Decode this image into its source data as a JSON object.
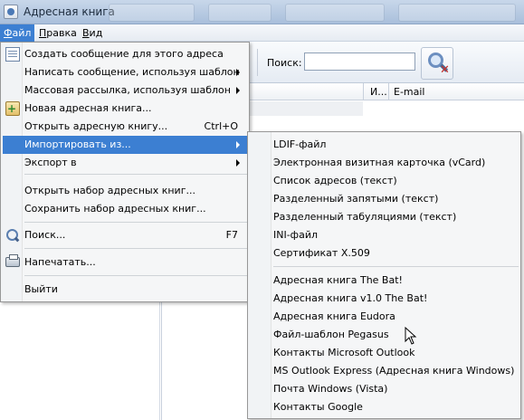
{
  "window": {
    "title": "Адресная книга"
  },
  "menubar": {
    "items": [
      {
        "label": "Файл",
        "underline": "Ф",
        "active": true
      },
      {
        "label": "Правка",
        "underline": "П",
        "active": false
      },
      {
        "label": "Вид",
        "underline": "В",
        "active": false
      }
    ]
  },
  "toolbar": {
    "search_label": "Поиск:",
    "search_value": ""
  },
  "grid": {
    "columns": [
      "И...",
      "E-mail"
    ]
  },
  "file_menu": {
    "items": [
      {
        "label": "Создать сообщение для этого адреса",
        "shortcut": "",
        "submenu": false,
        "icon": "new-message-icon"
      },
      {
        "label": "Написать сообщение, используя шаблон",
        "shortcut": "",
        "submenu": true
      },
      {
        "label": "Массовая рассылка, используя шаблон",
        "shortcut": "",
        "submenu": true
      },
      {
        "label": "Новая адресная книга...",
        "shortcut": "",
        "submenu": false,
        "icon": "new-address-book-icon"
      },
      {
        "label": "Открыть адресную книгу...",
        "shortcut": "Ctrl+O",
        "submenu": false
      },
      {
        "label": "Импортировать из...",
        "shortcut": "",
        "submenu": true,
        "highlighted": true
      },
      {
        "label": "Экспорт в",
        "shortcut": "",
        "submenu": true
      },
      {
        "label": "Открыть набор адресных книг...",
        "shortcut": "",
        "submenu": false
      },
      {
        "label": "Сохранить набор адресных книг...",
        "shortcut": "",
        "submenu": false
      },
      {
        "label": "Поиск...",
        "shortcut": "F7",
        "submenu": false,
        "icon": "search-icon"
      },
      {
        "label": "Напечатать...",
        "shortcut": "",
        "submenu": false,
        "icon": "printer-icon"
      },
      {
        "label": "Выйти",
        "shortcut": "",
        "submenu": false
      }
    ]
  },
  "import_menu": {
    "items": [
      "LDIF-файл",
      "Электронная визитная карточка (vCard)",
      "Список адресов (текст)",
      "Разделенный запятыми (текст)",
      "Разделенный табуляциями (текст)",
      "INI-файл",
      "Сертификат X.509",
      "Адресная книга The Bat!",
      "Адресная книга v1.0 The Bat!",
      "Адресная книга Eudora",
      "Файл-шаблон Pegasus",
      "Контакты Microsoft Outlook",
      "MS Outlook Express (Адресная книга Windows)",
      "Почта Windows (Vista)",
      "Контакты Google"
    ]
  }
}
